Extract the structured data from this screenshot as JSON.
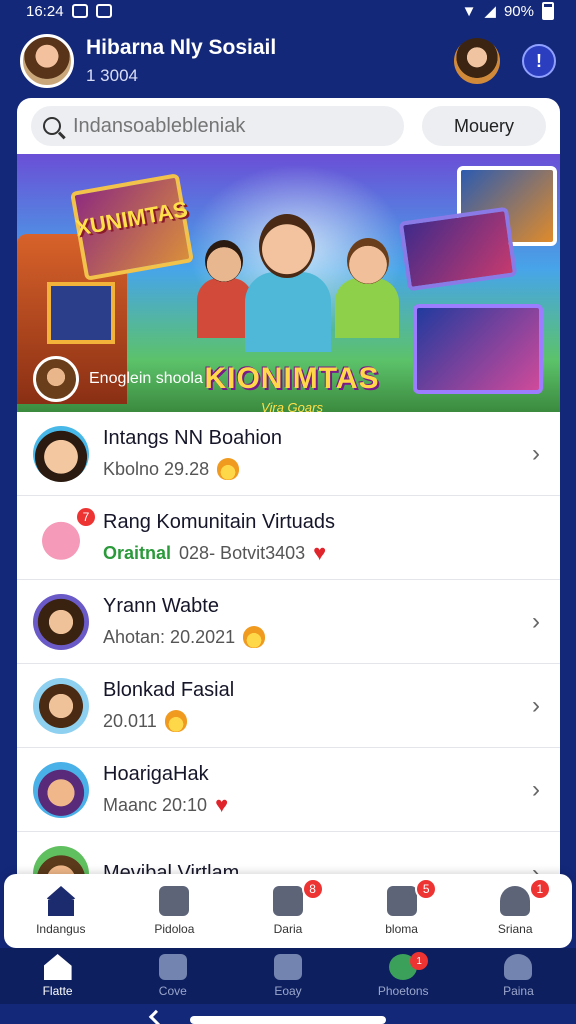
{
  "status": {
    "time": "16:24",
    "battery": "90%"
  },
  "header": {
    "title": "Hibarna Nly Sosiail",
    "subtitle": "1 3004",
    "alert_label": "!"
  },
  "search": {
    "placeholder": "Indansoablebleniak",
    "mode_label": "Mouery"
  },
  "banner": {
    "logo_top": "XUNIMTAS",
    "logo": "KIONIMTAS",
    "logo_sub": "Vira Goars",
    "caption": "Enoglein shoola"
  },
  "list": [
    {
      "title": "Intangs NN Boahion",
      "sub": "Kbolno 29.28",
      "emoji": "flame",
      "badge": ""
    },
    {
      "title": "Rang Komunitain Virtuads",
      "sub_green": "Oraitnal",
      "sub": "028- Botvit3403",
      "emoji": "heart",
      "badge": "7"
    },
    {
      "title": "Yrann Wabte",
      "sub": "Ahotan: 20.2021",
      "emoji": "flame",
      "badge": ""
    },
    {
      "title": "Blonkad Fasial",
      "sub": "20.011",
      "emoji": "flame",
      "badge": ""
    },
    {
      "title": "HoarigaHak",
      "sub": "Maanc 20:10",
      "emoji": "heart",
      "badge": ""
    },
    {
      "title": "Mevibal Virtlam",
      "sub": "",
      "emoji": "",
      "badge": ""
    }
  ],
  "bottom_tabs": [
    {
      "label": "Indangus",
      "badge": ""
    },
    {
      "label": "Pidoloa",
      "badge": ""
    },
    {
      "label": "Daria",
      "badge": "8"
    },
    {
      "label": "bloma",
      "badge": "5"
    },
    {
      "label": "Sriana",
      "badge": "1"
    }
  ],
  "nav": [
    {
      "label": "Flatte",
      "badge": ""
    },
    {
      "label": "Cove",
      "badge": ""
    },
    {
      "label": "Eoay",
      "badge": ""
    },
    {
      "label": "Phoetons",
      "badge": "1"
    },
    {
      "label": "Paina",
      "badge": ""
    }
  ]
}
